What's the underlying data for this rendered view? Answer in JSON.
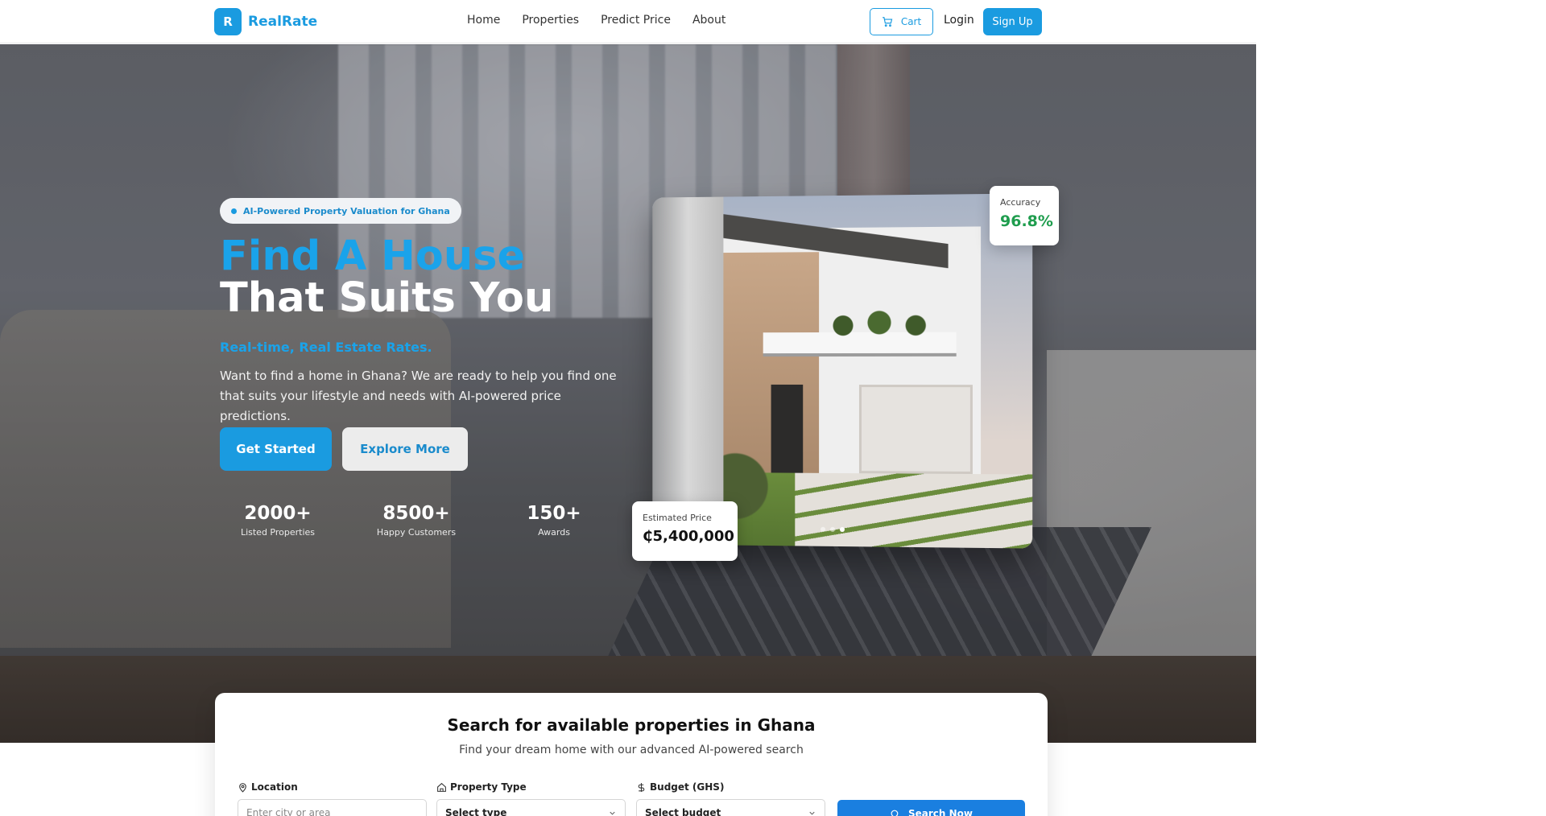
{
  "brand": {
    "logo_letter": "R",
    "name": "RealRate",
    "color": "#1a9be0"
  },
  "nav": {
    "links": [
      "Home",
      "Properties",
      "Predict Price",
      "About"
    ],
    "cart_label": "Cart",
    "login_label": "Login",
    "signup_label": "Sign Up"
  },
  "hero": {
    "badge": "AI-Powered Property Valuation for Ghana",
    "title_line1": "Find A House",
    "title_line2": "That Suits You",
    "tagline": "Real-time, Real Estate Rates.",
    "description": "Want to find a home in Ghana? We are ready to help you find one that suits your lifestyle and needs with AI-powered price predictions.",
    "cta_primary": "Get Started",
    "cta_secondary": "Explore More",
    "stats": [
      {
        "value": "2000+",
        "label": "Listed Properties"
      },
      {
        "value": "8500+",
        "label": "Happy Customers"
      },
      {
        "value": "150+",
        "label": "Awards"
      }
    ],
    "accuracy": {
      "label": "Accuracy",
      "value": "96.8%",
      "color": "#1f9d4e"
    },
    "estimate": {
      "label": "Estimated Price",
      "value": "₵5,400,000"
    },
    "carousel": {
      "count": 3,
      "active_index": 2
    }
  },
  "search": {
    "title": "Search for available properties in Ghana",
    "subtitle": "Find your dream home with our advanced AI-powered search",
    "location": {
      "label": "Location",
      "placeholder": "Enter city or area"
    },
    "property_type": {
      "label": "Property Type",
      "value": "Select type"
    },
    "budget": {
      "label": "Budget (GHS)",
      "value": "Select budget"
    },
    "button_label": "Search Now"
  }
}
